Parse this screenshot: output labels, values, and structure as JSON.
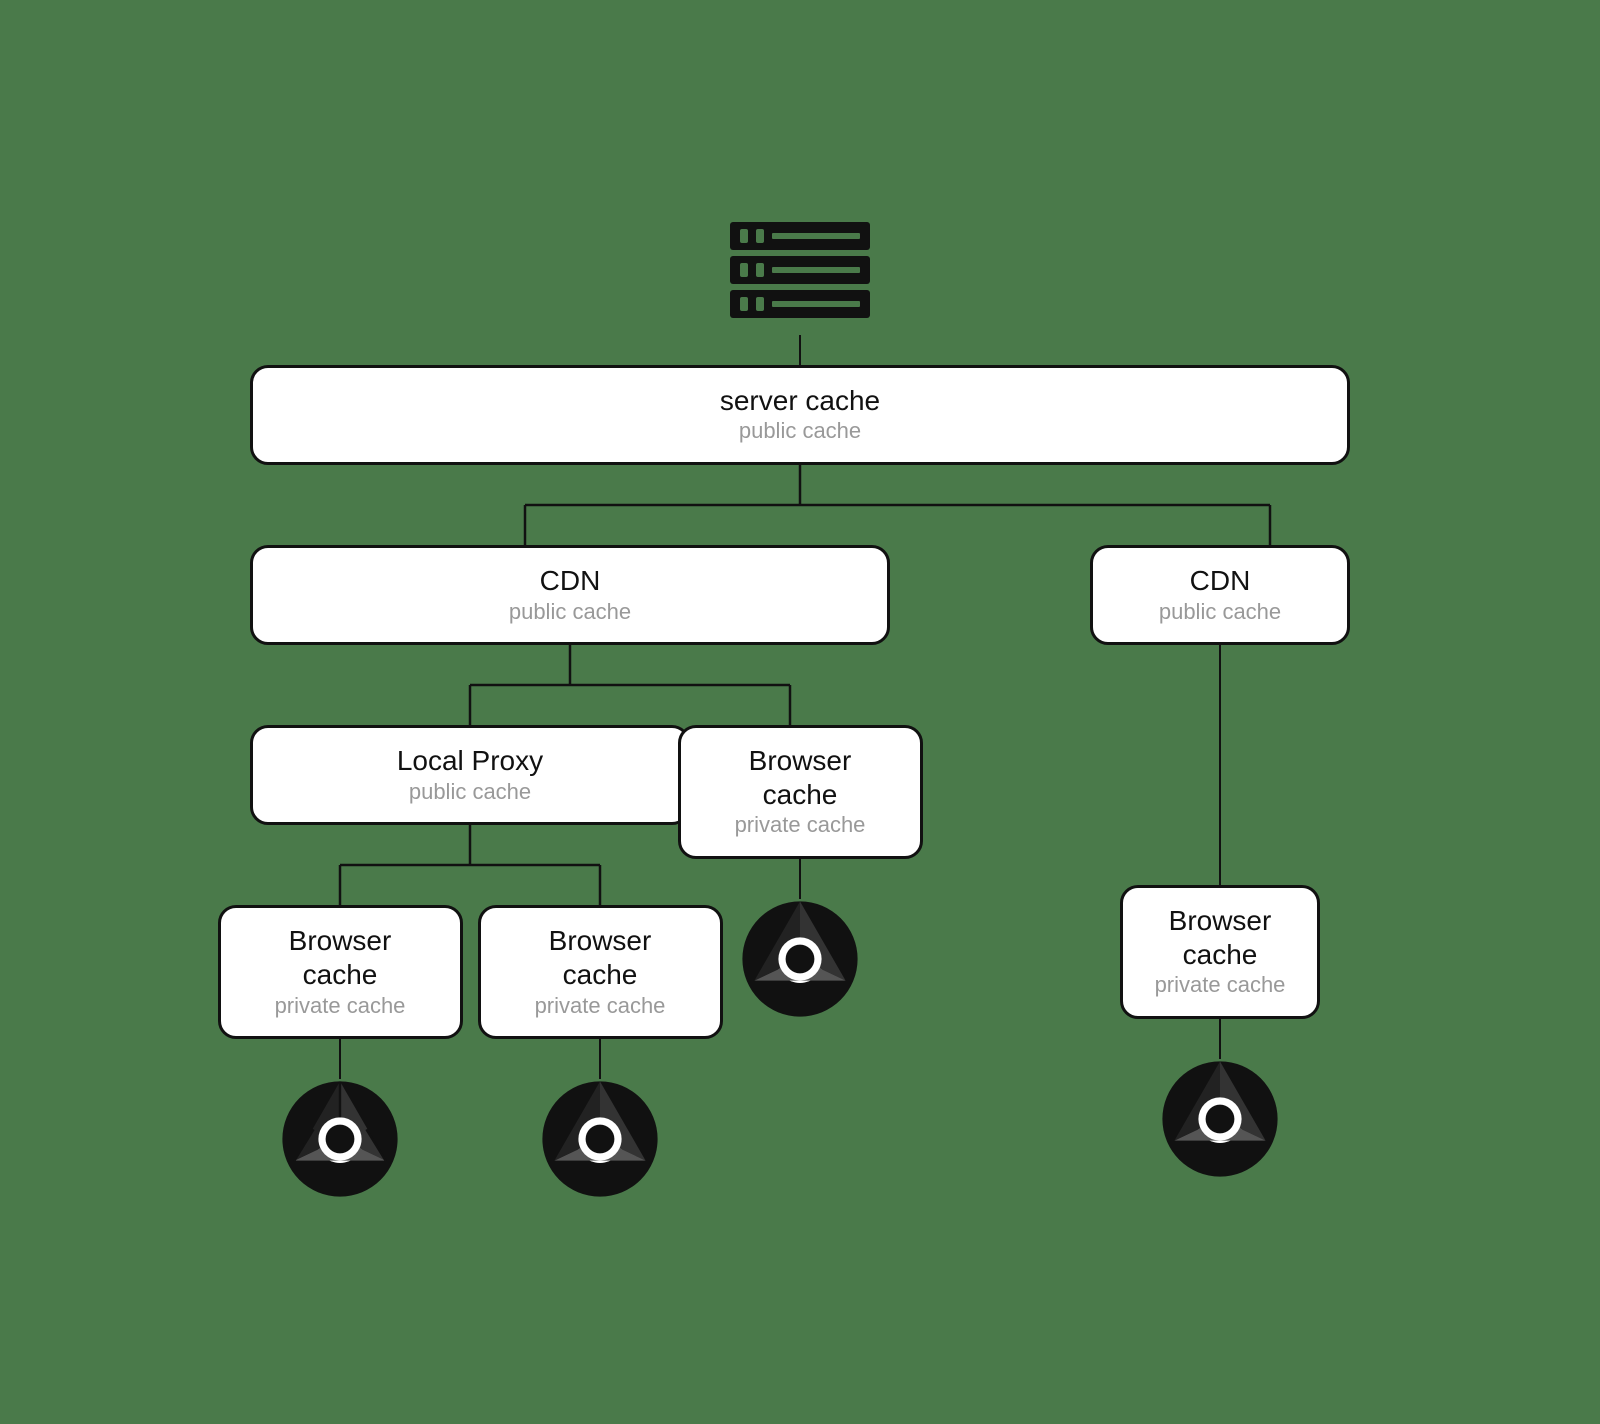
{
  "diagram": {
    "background": "#4a7a4a",
    "server": {
      "title": "server cache",
      "subtitle": "public cache"
    },
    "cdn_left": {
      "title": "CDN",
      "subtitle": "public cache"
    },
    "cdn_right": {
      "title": "CDN",
      "subtitle": "public cache"
    },
    "local_proxy": {
      "title": "Local Proxy",
      "subtitle": "public cache"
    },
    "browsers": [
      {
        "title": "Browser cache",
        "subtitle": "private cache"
      },
      {
        "title": "Browser cache",
        "subtitle": "private cache"
      },
      {
        "title": "Browser cache",
        "subtitle": "private cache"
      },
      {
        "title": "Browser cache",
        "subtitle": "private cache"
      }
    ]
  }
}
